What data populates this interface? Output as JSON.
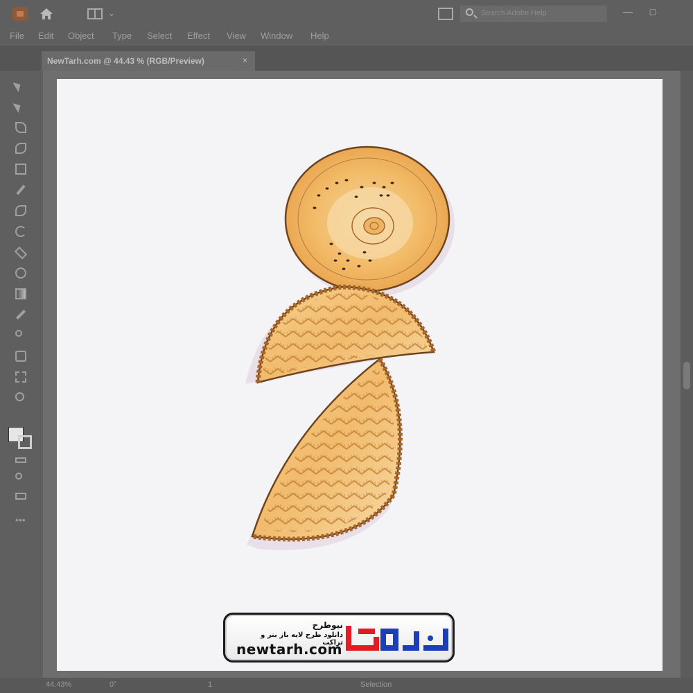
{
  "window": {
    "search_placeholder": "Search Adobe Help",
    "minimize": "—",
    "maximize": "□"
  },
  "menu": [
    "File",
    "Edit",
    "Object",
    "Type",
    "Select",
    "Effect",
    "View",
    "Window",
    "Help"
  ],
  "document_tab": {
    "label": "NewTarh.com @ 44.43 % (RGB/Preview)",
    "close": "×"
  },
  "status": {
    "zoom": "44.43%",
    "rotation": "0°",
    "artboard": "1",
    "mode": "Selection"
  },
  "brand": {
    "site": "newtarh.com",
    "fa_title": "نیوطرح",
    "fa_tagline": "دانلود طرح لایه باز بنر و تراکت",
    "logo_text": "نیوطرح",
    "colors": {
      "red": "#e21c22",
      "blue": "#1c3fb8"
    }
  },
  "artwork": {
    "colors": {
      "dough": "#f2b866",
      "dough_light": "#f8d89a",
      "outline": "#7a4a22",
      "shadow": "#e7dde6"
    }
  }
}
